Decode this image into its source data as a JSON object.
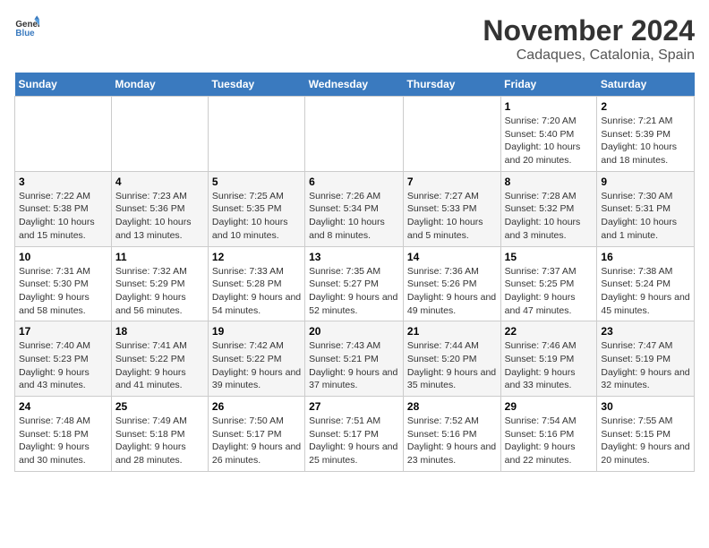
{
  "logo": {
    "text_general": "General",
    "text_blue": "Blue"
  },
  "header": {
    "month": "November 2024",
    "location": "Cadaques, Catalonia, Spain"
  },
  "weekdays": [
    "Sunday",
    "Monday",
    "Tuesday",
    "Wednesday",
    "Thursday",
    "Friday",
    "Saturday"
  ],
  "weeks": [
    [
      {
        "day": "",
        "info": ""
      },
      {
        "day": "",
        "info": ""
      },
      {
        "day": "",
        "info": ""
      },
      {
        "day": "",
        "info": ""
      },
      {
        "day": "",
        "info": ""
      },
      {
        "day": "1",
        "info": "Sunrise: 7:20 AM\nSunset: 5:40 PM\nDaylight: 10 hours and 20 minutes."
      },
      {
        "day": "2",
        "info": "Sunrise: 7:21 AM\nSunset: 5:39 PM\nDaylight: 10 hours and 18 minutes."
      }
    ],
    [
      {
        "day": "3",
        "info": "Sunrise: 7:22 AM\nSunset: 5:38 PM\nDaylight: 10 hours and 15 minutes."
      },
      {
        "day": "4",
        "info": "Sunrise: 7:23 AM\nSunset: 5:36 PM\nDaylight: 10 hours and 13 minutes."
      },
      {
        "day": "5",
        "info": "Sunrise: 7:25 AM\nSunset: 5:35 PM\nDaylight: 10 hours and 10 minutes."
      },
      {
        "day": "6",
        "info": "Sunrise: 7:26 AM\nSunset: 5:34 PM\nDaylight: 10 hours and 8 minutes."
      },
      {
        "day": "7",
        "info": "Sunrise: 7:27 AM\nSunset: 5:33 PM\nDaylight: 10 hours and 5 minutes."
      },
      {
        "day": "8",
        "info": "Sunrise: 7:28 AM\nSunset: 5:32 PM\nDaylight: 10 hours and 3 minutes."
      },
      {
        "day": "9",
        "info": "Sunrise: 7:30 AM\nSunset: 5:31 PM\nDaylight: 10 hours and 1 minute."
      }
    ],
    [
      {
        "day": "10",
        "info": "Sunrise: 7:31 AM\nSunset: 5:30 PM\nDaylight: 9 hours and 58 minutes."
      },
      {
        "day": "11",
        "info": "Sunrise: 7:32 AM\nSunset: 5:29 PM\nDaylight: 9 hours and 56 minutes."
      },
      {
        "day": "12",
        "info": "Sunrise: 7:33 AM\nSunset: 5:28 PM\nDaylight: 9 hours and 54 minutes."
      },
      {
        "day": "13",
        "info": "Sunrise: 7:35 AM\nSunset: 5:27 PM\nDaylight: 9 hours and 52 minutes."
      },
      {
        "day": "14",
        "info": "Sunrise: 7:36 AM\nSunset: 5:26 PM\nDaylight: 9 hours and 49 minutes."
      },
      {
        "day": "15",
        "info": "Sunrise: 7:37 AM\nSunset: 5:25 PM\nDaylight: 9 hours and 47 minutes."
      },
      {
        "day": "16",
        "info": "Sunrise: 7:38 AM\nSunset: 5:24 PM\nDaylight: 9 hours and 45 minutes."
      }
    ],
    [
      {
        "day": "17",
        "info": "Sunrise: 7:40 AM\nSunset: 5:23 PM\nDaylight: 9 hours and 43 minutes."
      },
      {
        "day": "18",
        "info": "Sunrise: 7:41 AM\nSunset: 5:22 PM\nDaylight: 9 hours and 41 minutes."
      },
      {
        "day": "19",
        "info": "Sunrise: 7:42 AM\nSunset: 5:22 PM\nDaylight: 9 hours and 39 minutes."
      },
      {
        "day": "20",
        "info": "Sunrise: 7:43 AM\nSunset: 5:21 PM\nDaylight: 9 hours and 37 minutes."
      },
      {
        "day": "21",
        "info": "Sunrise: 7:44 AM\nSunset: 5:20 PM\nDaylight: 9 hours and 35 minutes."
      },
      {
        "day": "22",
        "info": "Sunrise: 7:46 AM\nSunset: 5:19 PM\nDaylight: 9 hours and 33 minutes."
      },
      {
        "day": "23",
        "info": "Sunrise: 7:47 AM\nSunset: 5:19 PM\nDaylight: 9 hours and 32 minutes."
      }
    ],
    [
      {
        "day": "24",
        "info": "Sunrise: 7:48 AM\nSunset: 5:18 PM\nDaylight: 9 hours and 30 minutes."
      },
      {
        "day": "25",
        "info": "Sunrise: 7:49 AM\nSunset: 5:18 PM\nDaylight: 9 hours and 28 minutes."
      },
      {
        "day": "26",
        "info": "Sunrise: 7:50 AM\nSunset: 5:17 PM\nDaylight: 9 hours and 26 minutes."
      },
      {
        "day": "27",
        "info": "Sunrise: 7:51 AM\nSunset: 5:17 PM\nDaylight: 9 hours and 25 minutes."
      },
      {
        "day": "28",
        "info": "Sunrise: 7:52 AM\nSunset: 5:16 PM\nDaylight: 9 hours and 23 minutes."
      },
      {
        "day": "29",
        "info": "Sunrise: 7:54 AM\nSunset: 5:16 PM\nDaylight: 9 hours and 22 minutes."
      },
      {
        "day": "30",
        "info": "Sunrise: 7:55 AM\nSunset: 5:15 PM\nDaylight: 9 hours and 20 minutes."
      }
    ]
  ]
}
